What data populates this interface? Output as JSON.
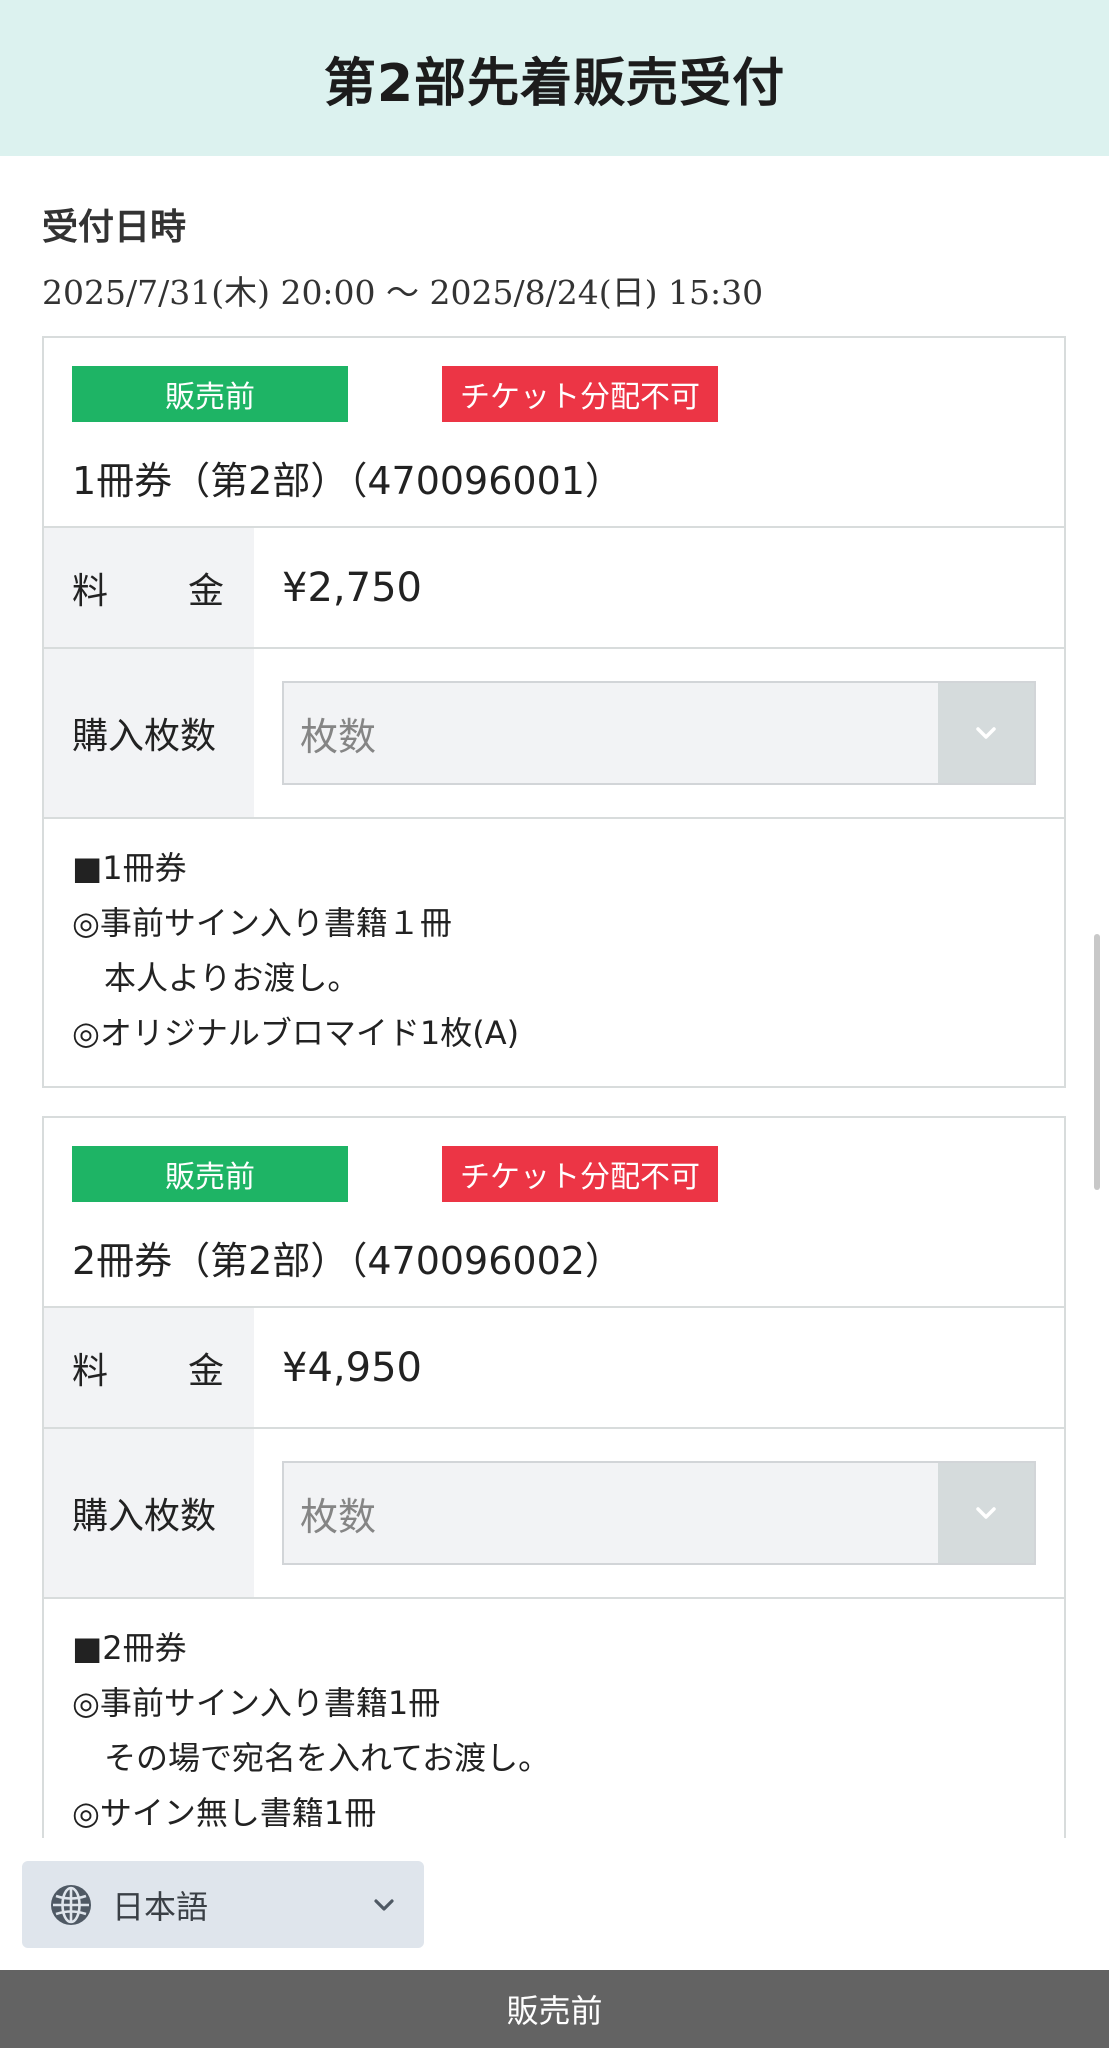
{
  "header": {
    "title": "第2部先着販売受付"
  },
  "reception": {
    "label": "受付日時",
    "dates": "2025/7/31(木) 20:00 〜 2025/8/24(日) 15:30"
  },
  "tickets": [
    {
      "status_badge": "販売前",
      "alert_badge": "チケット分配不可",
      "name": "1冊券（第2部）（470096001）",
      "price_label_1": "料",
      "price_label_2": "金",
      "price": "¥2,750",
      "qty_label": "購入枚数",
      "qty_placeholder": "枚数",
      "description": [
        "■1冊券",
        "◎事前サイン入り書籍１冊",
        "　本人よりお渡し。",
        "◎オリジナルブロマイド1枚(A)"
      ]
    },
    {
      "status_badge": "販売前",
      "alert_badge": "チケット分配不可",
      "name": "2冊券（第2部）（470096002）",
      "price_label_1": "料",
      "price_label_2": "金",
      "price": "¥4,950",
      "qty_label": "購入枚数",
      "qty_placeholder": "枚数",
      "description": [
        "■2冊券",
        "◎事前サイン入り書籍1冊",
        "　その場で宛名を入れてお渡し。",
        "◎サイン無し書籍1冊"
      ]
    }
  ],
  "language": {
    "selected": "日本語",
    "icon": "globe-icon"
  },
  "footer": {
    "status": "販売前"
  },
  "colors": {
    "header_bg": "#dcf2ef",
    "status_badge": "#1eb465",
    "alert_badge": "#ec3545",
    "footer_bg": "#636363"
  }
}
